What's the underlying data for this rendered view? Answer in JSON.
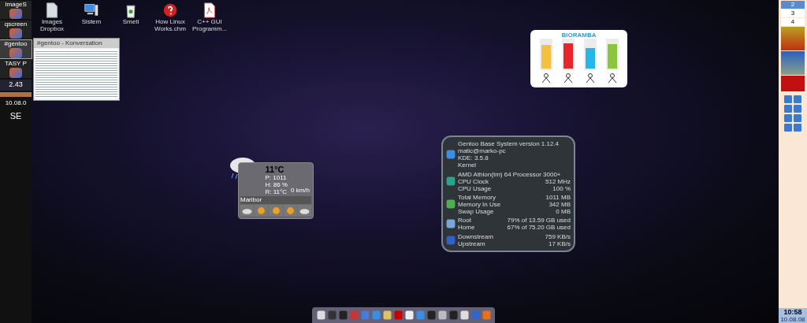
{
  "left_panel": {
    "items": [
      {
        "label": "ImageS",
        "selected": false
      },
      {
        "label": "qscreen",
        "selected": false
      },
      {
        "label": "#gentoo",
        "selected": true
      },
      {
        "label": "TASY P",
        "selected": false
      }
    ],
    "meter": "2.43",
    "date": "10.08.0",
    "time": "SE"
  },
  "desktop_icons": [
    {
      "label": "Images Dropbox",
      "kind": "file"
    },
    {
      "label": "Sistem",
      "kind": "computer"
    },
    {
      "label": "Smeti",
      "kind": "trash"
    },
    {
      "label": "How Linux Works.chm",
      "kind": "help"
    },
    {
      "label": "C++ GUI Programm...",
      "kind": "pdf"
    }
  ],
  "preview_window": {
    "title": "#gentoo - Konversation"
  },
  "bioramba": {
    "title": "BIORAMBA",
    "bars": [
      {
        "color": "#f4c042",
        "level": 0.82
      },
      {
        "color": "#e8252a",
        "level": 0.9
      },
      {
        "color": "#27b6ea",
        "level": 0.72
      },
      {
        "color": "#8cc63f",
        "level": 0.85
      }
    ]
  },
  "weather": {
    "temperature": "11°C",
    "details": [
      "P: 1011",
      "H: 86 %",
      "R: 11°C"
    ],
    "wind": "0 km/h",
    "city": "Maribor",
    "days": [
      {
        "kind": "cloud"
      },
      {
        "kind": "sun"
      },
      {
        "kind": "sun"
      },
      {
        "kind": "sun"
      },
      {
        "kind": "cloud"
      }
    ]
  },
  "system_info": {
    "sections": [
      {
        "kind": "system",
        "rows": [
          {
            "label": "Gentoo Base System version 1.12.4"
          },
          {
            "label": "matic@marko-pc"
          },
          {
            "label": "KDE: 3.5.8"
          },
          {
            "label": "Kernel"
          }
        ]
      },
      {
        "kind": "cpu",
        "rows": [
          {
            "label": "AMD Athlon(tm) 64 Processor 3000+"
          },
          {
            "label": "CPU Clock",
            "value": "512 MHz"
          },
          {
            "label": "CPU Usage",
            "value": "100 %"
          }
        ]
      },
      {
        "kind": "memory",
        "rows": [
          {
            "label": "Total Memory",
            "value": "1011 MB"
          },
          {
            "label": "Memory In Use",
            "value": "342 MB"
          },
          {
            "label": "Swap Usage",
            "value": "0 MB"
          }
        ]
      },
      {
        "kind": "disk",
        "rows": [
          {
            "label": "Root",
            "value": "79% of 13.59 GB used"
          },
          {
            "label": "Home",
            "value": "67% of 75.20 GB used"
          }
        ]
      },
      {
        "kind": "network",
        "rows": [
          {
            "label": "Downstream",
            "value": "759 KB/s"
          },
          {
            "label": "Upstream",
            "value": "17 KB/s"
          }
        ]
      }
    ]
  },
  "right_panel": {
    "desktops": [
      {
        "label": "2",
        "selected": true
      },
      {
        "label": "3",
        "selected": false
      },
      {
        "label": "4",
        "selected": false
      }
    ],
    "clock": "10:58",
    "date": "10.08.08"
  }
}
